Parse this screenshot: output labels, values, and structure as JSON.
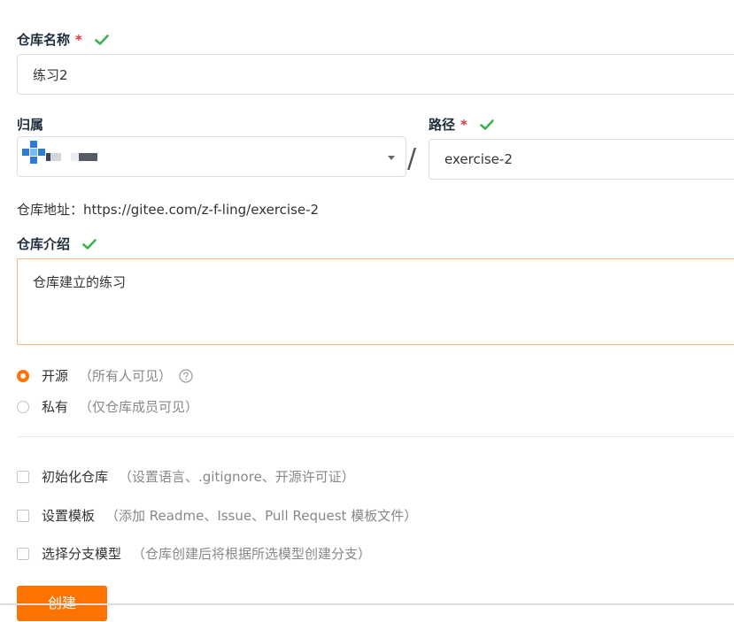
{
  "repo_name": {
    "label": "仓库名称",
    "required_mark": "*",
    "value": "练习2"
  },
  "owner": {
    "label": "归属"
  },
  "path": {
    "label": "路径",
    "required_mark": "*",
    "value": "exercise-2"
  },
  "separator": "/",
  "address": {
    "text": "仓库地址：https://gitee.com/z-f-ling/exercise-2"
  },
  "description": {
    "label": "仓库介绍",
    "value": "仓库建立的练习"
  },
  "visibility": {
    "options": [
      {
        "label": "开源",
        "note": "（所有人可见）",
        "selected": true
      },
      {
        "label": "私有",
        "note": "（仅仓库成员可见）",
        "selected": false
      }
    ]
  },
  "extras": [
    {
      "label": "初始化仓库",
      "note": "（设置语言、.gitignore、开源许可证）",
      "checked": false
    },
    {
      "label": "设置模板",
      "note": "（添加 Readme、Issue、Pull Request 模板文件）",
      "checked": false
    },
    {
      "label": "选择分支模型",
      "note": "（仓库创建后将根据所选模型创建分支）",
      "checked": false
    }
  ],
  "create_button": {
    "label": "创建"
  },
  "colors": {
    "accent": "#fe7300",
    "check": "#3cb24a",
    "required": "#e4393c"
  }
}
